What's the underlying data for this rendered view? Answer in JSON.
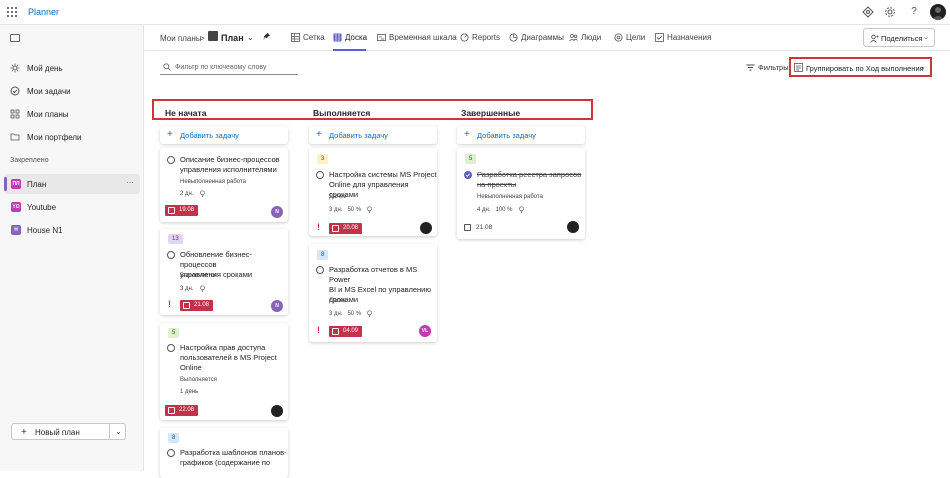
{
  "app": {
    "name": "Planner"
  },
  "sidebar": {
    "items": [
      {
        "label": "Мой день",
        "icon": "sun-icon"
      },
      {
        "label": "Мои задачи",
        "icon": "check-circle-icon"
      },
      {
        "label": "Мои планы",
        "icon": "grid-icon"
      },
      {
        "label": "Мои портфели",
        "icon": "folder-icon"
      }
    ],
    "section_label": "Закреплено",
    "pinned": [
      {
        "label": "План",
        "abbr": "ПЛ",
        "color": "#c239b3"
      },
      {
        "label": "Youtube",
        "abbr": "YO",
        "color": "#c239b3"
      },
      {
        "label": "House N1",
        "abbr": "H",
        "color": "#8764b8"
      }
    ],
    "more": "···",
    "new_plan": "Новый план"
  },
  "header": {
    "breadcrumb": "Мои планы",
    "breadcrumb_sep": ">",
    "plan_name": "План",
    "tabs": [
      {
        "label": "Сетка"
      },
      {
        "label": "Доска"
      },
      {
        "label": "Временная шкала"
      },
      {
        "label": "Reports"
      },
      {
        "label": "Диаграммы"
      },
      {
        "label": "Люди"
      },
      {
        "label": "Цели"
      },
      {
        "label": "Назначения"
      }
    ],
    "active_tab": "Доска",
    "share": "Поделиться"
  },
  "toolbar": {
    "filter_placeholder": "Фильтр по ключевому слову",
    "filters": "Фильтры",
    "group_by": "Группировать по Ход выполнения"
  },
  "board": {
    "add_task": "Добавить задачу",
    "columns": [
      {
        "title": "Не начата"
      },
      {
        "title": "Выполняется"
      },
      {
        "title": "Завершенные"
      }
    ],
    "cards": [
      {
        "title": [
          "Описание бизнес-процессов",
          "управления исполнителями"
        ],
        "bucket": "Невыполненная работа",
        "duration": "2 дн.",
        "due": "19.08",
        "avatar": "N"
      },
      {
        "label": "13",
        "title": [
          "Обновление бизнес-процессов",
          "управления сроками"
        ],
        "bucket": "Выполняется",
        "duration": "3 дн.",
        "due": "21.08",
        "avatar": "N"
      },
      {
        "label": "5",
        "title": [
          "Настройка прав доступа",
          "пользователей в MS Project",
          "Online"
        ],
        "bucket": "Выполняется",
        "duration": "1 день",
        "due": "22.08"
      },
      {
        "label": "8",
        "title": [
          "Разработка шаблонов планов-",
          "графиков (содержание по"
        ]
      },
      {
        "label": "3",
        "title": [
          "Настройка системы MS Project",
          "Online для управления сроками"
        ],
        "bucket": "Далее",
        "duration": "3 дн.",
        "progress": "50 %",
        "due": "20.08"
      },
      {
        "label": "8",
        "title": [
          "Разработка отчетов в MS Power",
          "BI и MS Excel по управлению",
          "сроками"
        ],
        "bucket": "Далее",
        "duration": "3 дн.",
        "progress": "50 %",
        "due": "04.09",
        "avatar": "VL"
      },
      {
        "label": "5",
        "title": [
          "Разработка реестра запросов",
          "на проекты"
        ],
        "bucket": "Невыполненная работа",
        "duration": "4 дн.",
        "progress": "100 %",
        "due": "21.08"
      }
    ],
    "priority_mark": "!"
  }
}
